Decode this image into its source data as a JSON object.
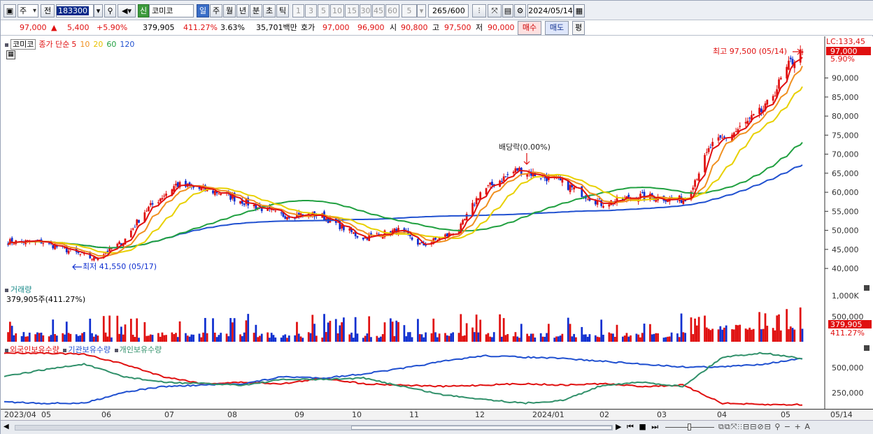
{
  "toolbar": {
    "period_type": "주",
    "jeon": "전",
    "code": "183300",
    "market_badge": "신",
    "name": "코미코",
    "periods": [
      "일",
      "주",
      "월",
      "년",
      "분",
      "초",
      "틱"
    ],
    "active_period": "일",
    "intervals": [
      "1",
      "3",
      "5",
      "10",
      "15",
      "30",
      "45",
      "60"
    ],
    "interval_value": "5",
    "count_shown": "265",
    "count_total": "/600",
    "date": "2024/05/14"
  },
  "quote": {
    "price": "97,000",
    "arrow": "▲",
    "change": "5,400",
    "change_pct": "+5.90%",
    "volume": "379,905",
    "volume_ratio": "411.27%",
    "turnover": "3.63%",
    "amount": "35,701백만",
    "hoga_label": "호가",
    "ask": "97,000",
    "bid": "96,900",
    "open_label": "시",
    "open": "90,800",
    "high_label": "고",
    "high": "97,500",
    "low_label": "저",
    "low": "90,000",
    "buy": "매수",
    "sell": "매도",
    "eval": "평"
  },
  "legend": {
    "name": "코미코",
    "label": "종가 단순",
    "ma": [
      {
        "label": "5",
        "color": "#e01010"
      },
      {
        "label": "10",
        "color": "#f09020"
      },
      {
        "label": "20",
        "color": "#e8d000"
      },
      {
        "label": "60",
        "color": "#20a040"
      },
      {
        "label": "120",
        "color": "#2050d0"
      }
    ]
  },
  "annotations": {
    "high": "최고 97,500 (05/14)",
    "low": "최저 41,550 (05/17)",
    "dividend": "배당락(0.00%)"
  },
  "price_axis": {
    "lc": "LC:133,45",
    "current": "97,000",
    "current_pct": "5.90%",
    "ticks": [
      "90,000",
      "85,000",
      "80,000",
      "75,000",
      "70,000",
      "65,000",
      "60,000",
      "55,000",
      "50,000",
      "45,000",
      "40,000"
    ]
  },
  "volume_pane": {
    "title": "거래량",
    "value": "379,905주(411.27%)",
    "ticks": [
      "1,000K",
      "500,000"
    ],
    "current": "379,905",
    "current_pct": "411.27%"
  },
  "holdings_pane": {
    "series": [
      {
        "name": "외국인보유수량",
        "color": "#e01010"
      },
      {
        "name": "기관보유수량",
        "color": "#2050d0"
      },
      {
        "name": "개인보유수량",
        "color": "#30906a"
      }
    ],
    "ticks": [
      "500,000",
      "250,000"
    ]
  },
  "x_axis": {
    "labels": [
      "2023/04",
      "05",
      "06",
      "07",
      "08",
      "09",
      "10",
      "11",
      "12",
      "2024/01",
      "02",
      "03",
      "04",
      "05",
      "05/14"
    ]
  },
  "colors": {
    "up": "#e01010",
    "down": "#1030d0",
    "ma5": "#e01010",
    "ma10": "#f09020",
    "ma20": "#e8d000",
    "ma60": "#20a040",
    "ma120": "#2050d0"
  },
  "chart_data": {
    "type": "candlestick",
    "y_range": [
      38000,
      98000
    ],
    "x_range": [
      "2023/04",
      "2024/05/14"
    ],
    "price_anchors": [
      {
        "date": "2023/04/20",
        "close": 47000
      },
      {
        "date": "2023/05/17",
        "close": 42500
      },
      {
        "date": "2023/06/01",
        "close": 47000
      },
      {
        "date": "2023/06/12",
        "close": 55000
      },
      {
        "date": "2023/06/28",
        "close": 62000
      },
      {
        "date": "2023/07/20",
        "close": 60000
      },
      {
        "date": "2023/08/20",
        "close": 54000
      },
      {
        "date": "2023/09/10",
        "close": 54000
      },
      {
        "date": "2023/10/01",
        "close": 48000
      },
      {
        "date": "2023/10/20",
        "close": 50000
      },
      {
        "date": "2023/11/01",
        "close": 46000
      },
      {
        "date": "2023/11/20",
        "close": 50000
      },
      {
        "date": "2023/12/01",
        "close": 60000
      },
      {
        "date": "2023/12/20",
        "close": 66000
      },
      {
        "date": "2024/01/10",
        "close": 63000
      },
      {
        "date": "2024/02/01",
        "close": 57000
      },
      {
        "date": "2024/02/20",
        "close": 59000
      },
      {
        "date": "2024/03/15",
        "close": 58000
      },
      {
        "date": "2024/03/28",
        "close": 72000
      },
      {
        "date": "2024/04/10",
        "close": 76000
      },
      {
        "date": "2024/04/25",
        "close": 82000
      },
      {
        "date": "2024/05/08",
        "close": 94000
      },
      {
        "date": "2024/05/14",
        "close": 97000
      }
    ],
    "high": {
      "date": "2024/05/14",
      "value": 97500
    },
    "low": {
      "date": "2023/05/17",
      "value": 41550
    }
  }
}
